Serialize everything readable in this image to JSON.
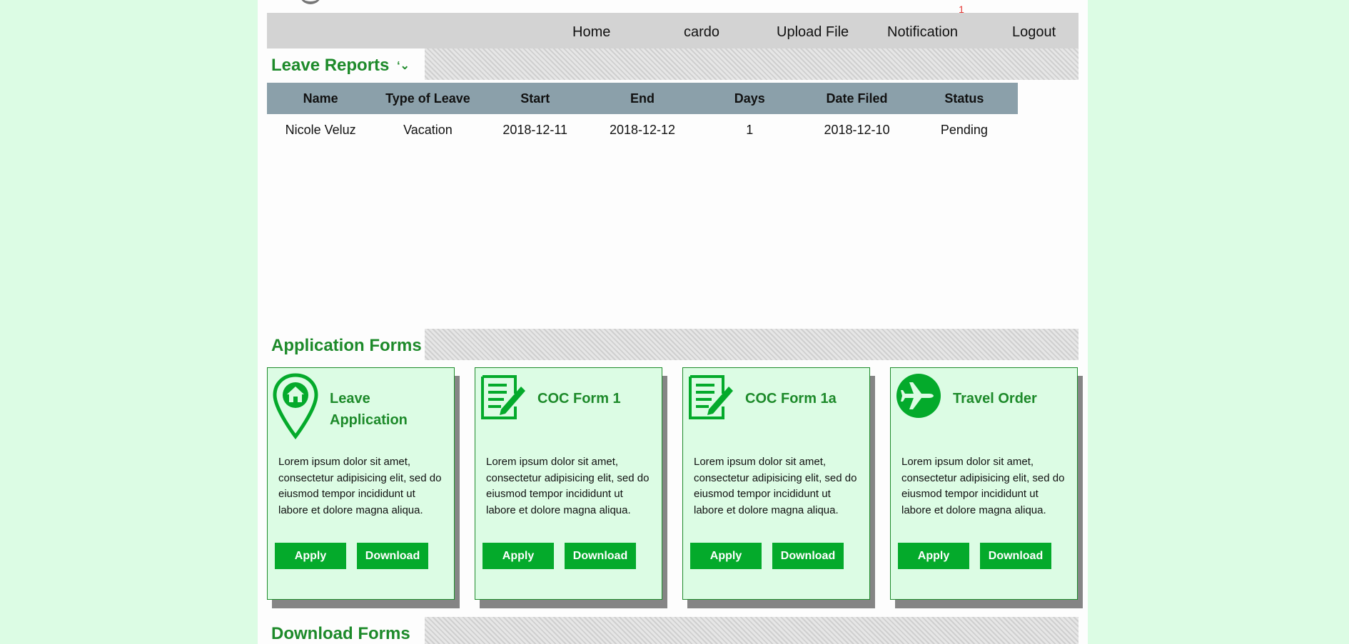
{
  "nav": {
    "items": [
      "Home",
      "cardo",
      "Upload File",
      "Notification",
      "Logout"
    ],
    "notification_count": "1"
  },
  "leave_reports": {
    "title": "Leave Reports ",
    "columns": [
      "Name",
      "Type of Leave",
      "Start",
      "End",
      "Days",
      "Date Filed",
      "Status"
    ],
    "rows": [
      [
        "Nicole Veluz",
        "Vacation",
        "2018-12-11",
        "2018-12-12",
        "1",
        "2018-12-10",
        "Pending"
      ]
    ]
  },
  "application_forms": {
    "title": "Application Forms",
    "cards": [
      {
        "title": "Leave Application",
        "icon": "map-pin-home-icon",
        "text": "Lorem ipsum dolor sit amet, consectetur adipisicing elit, sed do eiusmod tempor incididunt ut labore et dolore magna aliqua.",
        "apply_label": "Apply",
        "download_label": "Download"
      },
      {
        "title": "COC Form 1",
        "icon": "document-pencil-icon",
        "text": "Lorem ipsum dolor sit amet, consectetur adipisicing elit, sed do eiusmod tempor incididunt ut labore et dolore magna aliqua.",
        "apply_label": "Apply",
        "download_label": "Download"
      },
      {
        "title": "COC Form 1a",
        "icon": "document-pencil-icon",
        "text": "Lorem ipsum dolor sit amet, consectetur adipisicing elit, sed do eiusmod tempor incididunt ut labore et dolore magna aliqua.",
        "apply_label": "Apply",
        "download_label": "Download"
      },
      {
        "title": "Travel Order",
        "icon": "airplane-icon",
        "text": "Lorem ipsum dolor sit amet, consectetur adipisicing elit, sed do eiusmod tempor incididunt ut labore et dolore magna aliqua.",
        "apply_label": "Apply",
        "download_label": "Download"
      }
    ]
  },
  "download_forms": {
    "title": "Download Forms"
  },
  "colors": {
    "page_background": "#dcfce4",
    "accent_green": "#1d8a2a",
    "button_green": "#04aa2b",
    "nav_background": "#d3d3d3",
    "table_header": "#8ba0aa",
    "notification_badge": "#e53935"
  }
}
